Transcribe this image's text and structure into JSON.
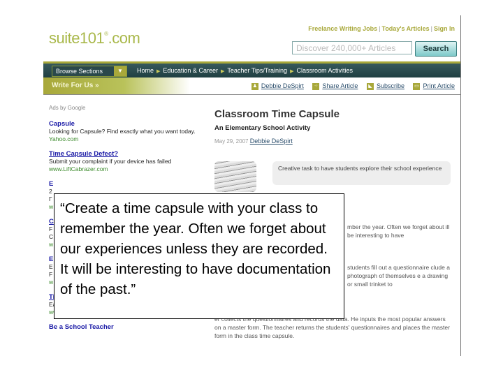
{
  "header": {
    "logo": "suite101",
    "logo_reg": "®",
    "logo_tld": ".com",
    "top_links": [
      "Freelance Writing Jobs",
      "Today's Articles",
      "Sign In"
    ],
    "search_placeholder": "Discover 240,000+ Articles",
    "search_button": "Search"
  },
  "nav": {
    "browse_label": "Browse Sections",
    "breadcrumbs": [
      "Home",
      "Education & Career",
      "Teacher Tips/Training",
      "Classroom Activities"
    ]
  },
  "subbar": {
    "write_for_us": "Write For Us »",
    "actions": [
      {
        "icon": "person-icon",
        "label": "Debbie DeSpirt"
      },
      {
        "icon": "share-icon",
        "label": "Share Article"
      },
      {
        "icon": "rss-icon",
        "label": "Subscribe"
      },
      {
        "icon": "print-icon",
        "label": "Print Article"
      }
    ]
  },
  "ads": {
    "label": "Ads by Google",
    "items": [
      {
        "title": "Capsule",
        "text": "Looking for Capsule? Find exactly what you want today.",
        "url": "Yahoo.com"
      },
      {
        "title": "Time Capsule Defect?",
        "text": "Submit your complaint if your device has failed",
        "url": "www.LiftCabrazer.com"
      },
      {
        "title": "E",
        "text": "2",
        "url": "w"
      },
      {
        "title": "C",
        "text": "F",
        "url": "w"
      },
      {
        "title": "E",
        "text": "E",
        "url": "w"
      },
      {
        "title": "Time Capsule Mounting",
        "text": "Easily wall or ceiling mount your Time Capsule",
        "url": "www.hsq.com"
      },
      {
        "title": "Be a School Teacher",
        "text": "",
        "url": ""
      }
    ]
  },
  "article": {
    "title": "Classroom Time Capsule",
    "subtitle": "An Elementary School Activity",
    "date": "May 29, 2007",
    "author": "Debbie DeSpirt",
    "summary": "Creative task to have students explore their school experience",
    "para1": "mber the year. Often we forget about ill be interesting to have",
    "para2": "students fill out a questionnaire clude a photograph of themselves e a drawing or small trinket to",
    "para3": "er collects the questionnaires and records the data. He inputs the most popular answers on a master form. The teacher returns the students' questionnaires and places the master form in the class time capsule."
  },
  "quote": "“Create a time capsule with your class to remember the year. Often we forget about our experiences unless they are recorded. It will be interesting to have documentation of the past.”"
}
